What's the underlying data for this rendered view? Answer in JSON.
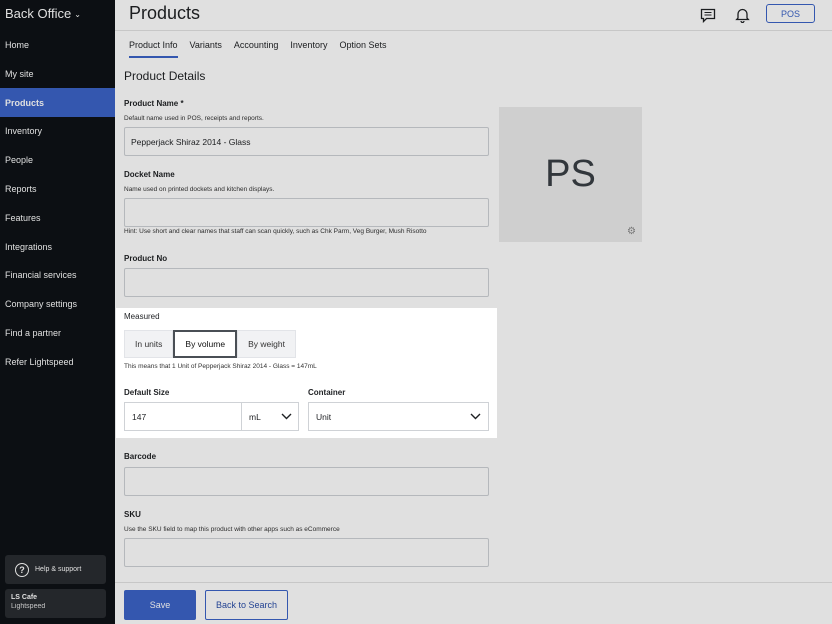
{
  "brand": {
    "title": "Back Office"
  },
  "sidebar": {
    "items": [
      {
        "label": "Home",
        "active": false
      },
      {
        "label": "My site",
        "active": false
      },
      {
        "label": "Products",
        "active": true
      },
      {
        "label": "Inventory",
        "active": false
      },
      {
        "label": "People",
        "active": false
      },
      {
        "label": "Reports",
        "active": false
      },
      {
        "label": "Features",
        "active": false
      },
      {
        "label": "Integrations",
        "active": false
      },
      {
        "label": "Financial services",
        "active": false
      },
      {
        "label": "Company settings",
        "active": false
      },
      {
        "label": "Find a partner",
        "active": false
      },
      {
        "label": "Refer Lightspeed",
        "active": false
      }
    ],
    "help_label": "Help & support",
    "account_name": "LS Cafe",
    "account_sub": "Lightspeed"
  },
  "header": {
    "title": "Products",
    "pos_label": "POS",
    "icons": [
      "chat-icon",
      "bell-icon"
    ]
  },
  "tabs": [
    {
      "label": "Product Info",
      "active": true
    },
    {
      "label": "Variants",
      "active": false
    },
    {
      "label": "Accounting",
      "active": false
    },
    {
      "label": "Inventory",
      "active": false
    },
    {
      "label": "Option Sets",
      "active": false
    }
  ],
  "form": {
    "section_title": "Product Details",
    "product_name_label": "Product Name *",
    "product_name_help": "Default name used in POS, receipts and reports.",
    "product_name_value": "Pepperjack Shiraz 2014 -  Glass",
    "docket_name_label": "Docket Name",
    "docket_name_help": "Name used on printed dockets and kitchen displays.",
    "docket_name_value": "",
    "docket_hint": "Hint: Use short and clear names that staff can scan quickly, such as Chk Parm, Veg Burger, Mush Risotto",
    "product_no_label": "Product No",
    "product_no_value": "",
    "image_initials": "PS",
    "barcode_label": "Barcode",
    "barcode_value": "",
    "sku_label": "SKU",
    "sku_help": "Use the SKU field to map this product with other apps such as eCommerce",
    "sku_value": ""
  },
  "measured": {
    "label": "Measured",
    "options": [
      {
        "label": "In units",
        "active": false
      },
      {
        "label": "By volume",
        "active": true
      },
      {
        "label": "By weight",
        "active": false
      }
    ],
    "note": "This means that 1 Unit of Pepperjack Shiraz 2014 - Glass = 147mL",
    "default_size_label": "Default Size",
    "default_size_value": "147",
    "unit_value": "mL",
    "container_label": "Container",
    "container_value": "Unit"
  },
  "footer": {
    "save_label": "Save",
    "back_label": "Back to Search"
  },
  "colors": {
    "accent": "#3c64c8",
    "sidebar_bg": "#0e1216"
  }
}
